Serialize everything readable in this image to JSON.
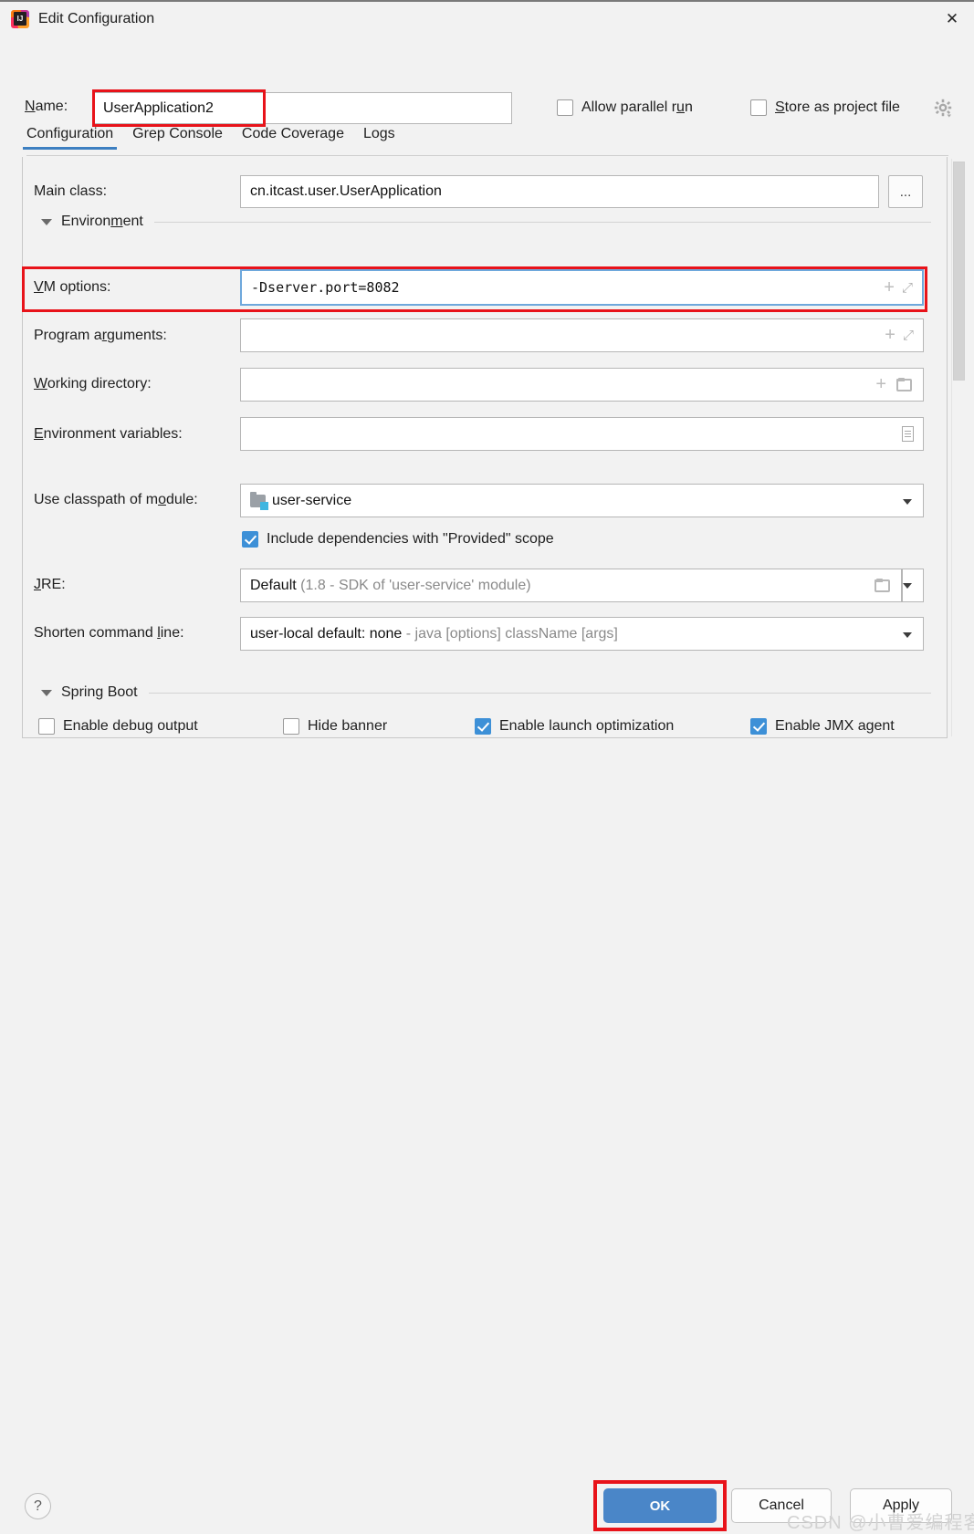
{
  "window": {
    "title": "Edit Configuration",
    "app_icon": "intellij-idea-icon",
    "close_icon": "✕"
  },
  "name_row": {
    "label": "Name:",
    "label_mnemonic": "N",
    "value": "UserApplication2",
    "allow_parallel_run": {
      "label": "Allow parallel run",
      "checked": false,
      "mnemonic": "u"
    },
    "store_as_project_file": {
      "label": "Store as project file",
      "checked": false,
      "mnemonic": "S"
    },
    "gear_icon": "gear-icon"
  },
  "tabs": [
    {
      "label": "Configuration",
      "active": true
    },
    {
      "label": "Grep Console",
      "active": false
    },
    {
      "label": "Code Coverage",
      "active": false
    },
    {
      "label": "Logs",
      "active": false
    }
  ],
  "form": {
    "main_class": {
      "label": "Main class:",
      "value": "cn.itcast.user.UserApplication",
      "browse_button": "..."
    },
    "environment_section": {
      "title": "Environment",
      "mnemonic": "m",
      "expanded": true
    },
    "vm_options": {
      "label": "VM options:",
      "mnemonic": "V",
      "value": "-Dserver.port=8082",
      "placeholder": "",
      "focused": true,
      "highlighted": true,
      "icons": [
        "plus-icon",
        "expand-icon"
      ]
    },
    "program_arguments": {
      "label": "Program arguments:",
      "mnemonic": "r",
      "value": "",
      "icons": [
        "plus-icon",
        "expand-icon"
      ]
    },
    "working_directory": {
      "label": "Working directory:",
      "mnemonic": "W",
      "value": "",
      "icons": [
        "plus-icon",
        "folder-icon"
      ]
    },
    "environment_variables": {
      "label": "Environment variables:",
      "mnemonic": "E",
      "value": "",
      "icons": [
        "env-list-icon"
      ]
    },
    "use_classpath_of_module": {
      "label": "Use classpath of module:",
      "mnemonic": "o",
      "value": "user-service",
      "icon": "module-icon"
    },
    "include_provided_scope": {
      "label": "Include dependencies with \"Provided\" scope",
      "checked": true
    },
    "jre": {
      "label": "JRE:",
      "mnemonic": "J",
      "value": "Default",
      "value_detail": "(1.8 - SDK of 'user-service' module)",
      "icons": [
        "folder-icon",
        "chevron-down-icon"
      ]
    },
    "shorten_command_line": {
      "label": "Shorten command line:",
      "mnemonic": "l",
      "value": "user-local default: none",
      "value_detail": "- java [options] className [args]"
    },
    "spring_boot_section": {
      "title": "Spring Boot",
      "expanded": true
    },
    "spring_boot_options": [
      {
        "label": "Enable debug output",
        "checked": false
      },
      {
        "label": "Hide banner",
        "checked": false
      },
      {
        "label": "Enable launch optimization",
        "checked": true
      },
      {
        "label": "Enable JMX agent",
        "checked": true
      }
    ]
  },
  "footer": {
    "help": "?",
    "ok": "OK",
    "cancel": "Cancel",
    "apply": "Apply"
  },
  "watermark": "CSDN @小曹爱编程客",
  "colors": {
    "accent": "#4a86c8",
    "checkbox_checked": "#3d90d7",
    "highlight_red": "#e8131a",
    "focus_border": "#6ea8dc",
    "background": "#f2f2f2"
  }
}
